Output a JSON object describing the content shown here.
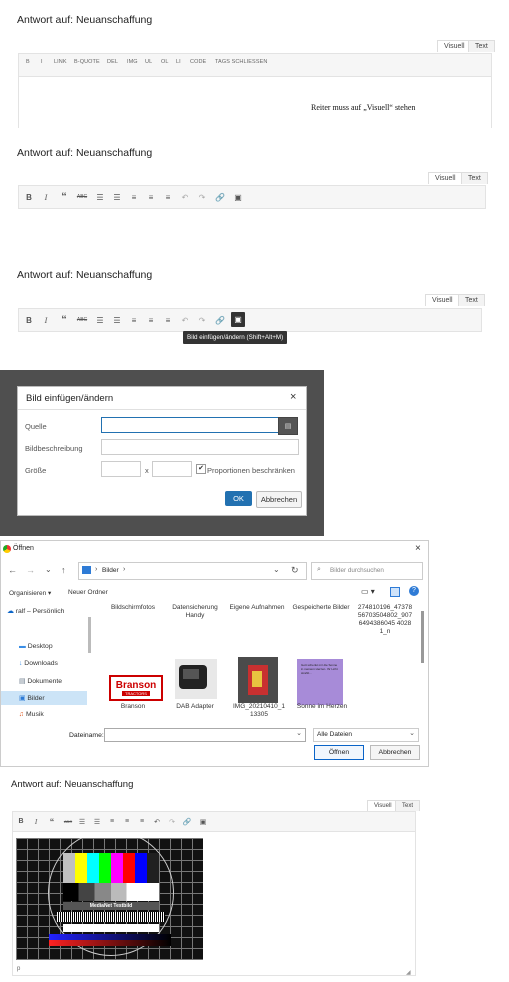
{
  "section1": {
    "title": "Antwort auf: Neuanschaffung",
    "tab_visual": "Visuell",
    "tab_text": "Text",
    "quicktags": [
      "B",
      "I",
      "LINK",
      "B-QUOTE",
      "DEL",
      "IMG",
      "UL",
      "OL",
      "LI",
      "CODE",
      "TAGS SCHLIESSEN"
    ],
    "annotation": "Reiter muss auf „Visuell“ stehen"
  },
  "section2": {
    "title": "Antwort auf: Neuanschaffung",
    "tab_visual": "Visuell",
    "tab_text": "Text"
  },
  "section3": {
    "title": "Antwort auf: Neuanschaffung",
    "tab_visual": "Visuell",
    "tab_text": "Text",
    "tooltip": "Bild einfügen/ändern (Shift+Alt+M)"
  },
  "dialog": {
    "title": "Bild einfügen/ändern",
    "close": "×",
    "source_label": "Quelle",
    "description_label": "Bildbeschreibung",
    "size_label": "Größe",
    "size_x": "x",
    "constrain_label": "Proportionen beschränken",
    "ok": "OK",
    "cancel": "Abbrechen"
  },
  "file_dialog": {
    "title": "Öffnen",
    "path_root": "Bilder",
    "path_sep": "›",
    "search_placeholder": "Bilder durchsuchen",
    "organize": "Organisieren ▾",
    "new_folder": "Neuer Ordner",
    "sidebar": [
      "ralf – Persönlich",
      "Desktop",
      "Downloads",
      "Dokumente",
      "Bilder",
      "Musik"
    ],
    "folders": [
      "Bildschirmfotos",
      "Datensicherung Handy",
      "Eigene Aufnahmen",
      "Gespeicherte Bilder"
    ],
    "file_long": "274810196_4737856703504802_9076494386045 40281_n",
    "files": [
      "Branson",
      "DAB Adapter",
      "IMG_20210410_1 13305",
      "Sonne im Herzen"
    ],
    "filename_label": "Dateiname:",
    "filter": "Alle Dateien",
    "open": "Öffnen",
    "cancel": "Abbrechen",
    "thumb_branson": "Branson",
    "thumb_branson_sub": "TRACTORS",
    "thumb_sonne": "Gott schenkt mir die Sonne in meinem Herzen. Ihr Licht strahlt..."
  },
  "section4": {
    "title": "Antwort auf: Neuanschaffung",
    "tab_visual": "Visuell",
    "tab_text": "Text",
    "testcard_label": "MediaNet Testbild",
    "status_p": "p"
  },
  "colors": {
    "accent": "#2271b1",
    "testbar": [
      "#c0c0c0",
      "#ffff00",
      "#00ffff",
      "#00ff00",
      "#ff00ff",
      "#ff0000",
      "#0000ff",
      "#202020"
    ]
  }
}
